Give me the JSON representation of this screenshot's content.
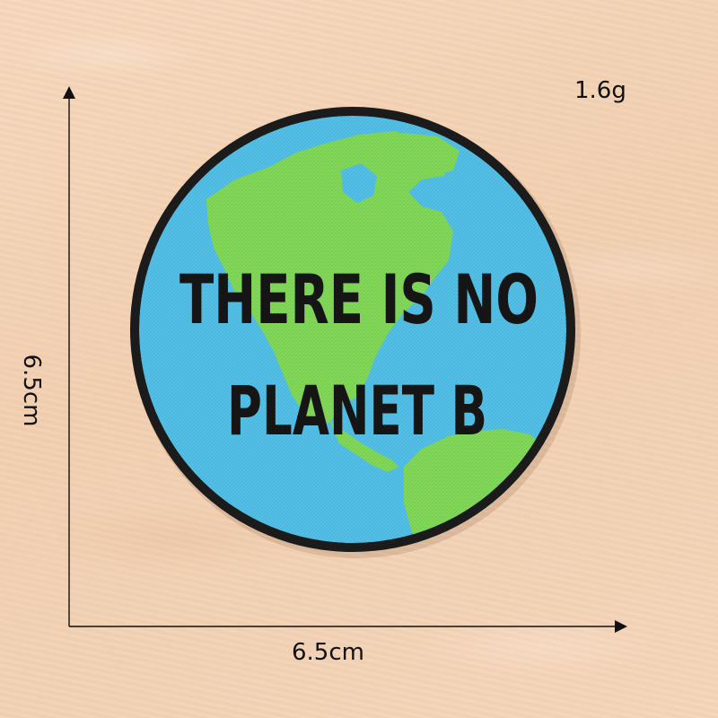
{
  "photo": {
    "subject": "round-embroidered-earth-patch",
    "colors": {
      "background": "#f3d2b5",
      "ocean": "#4ab8df",
      "land": "#7ad150",
      "border": "#1b1b1b",
      "text": "#151515"
    }
  },
  "patch": {
    "text_line_1": "THERE IS NO",
    "text_line_2": "PLANET B"
  },
  "measurements": {
    "weight": "1.6g",
    "width": "6.5cm",
    "height": "6.5cm"
  }
}
